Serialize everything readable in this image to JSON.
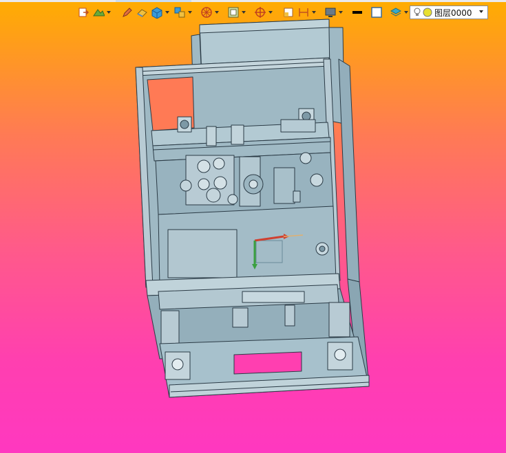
{
  "toolbar": {
    "icons": [
      {
        "name": "exit-icon",
        "caret": false
      },
      {
        "name": "flatten-icon",
        "caret": true
      },
      {
        "name": "pencil-icon",
        "caret": false
      },
      {
        "name": "eraser-icon",
        "caret": false
      },
      {
        "name": "solid-cube-icon",
        "caret": true
      },
      {
        "name": "view-orientation-icon",
        "caret": true
      },
      {
        "name": "wheel-icon",
        "caret": true
      },
      {
        "name": "frame-icon",
        "caret": true
      },
      {
        "name": "target-icon",
        "caret": true
      },
      {
        "name": "section-icon",
        "caret": false
      },
      {
        "name": "dimension-icon",
        "caret": true
      },
      {
        "name": "monitor-icon",
        "caret": true
      },
      {
        "name": "black-line-icon",
        "caret": false
      },
      {
        "name": "white-box-icon",
        "caret": false
      },
      {
        "name": "layers-icon",
        "caret": true
      }
    ]
  },
  "layer": {
    "name": "图层0000",
    "icons": [
      "light-bulb-icon",
      "yellow-circle-icon"
    ]
  },
  "colors": {
    "gradient_top": "#ffad00",
    "gradient_bottom": "#ff38c0",
    "model_fill": "#a7c1cc",
    "model_line": "#2a3a45",
    "model_window": "#ff3fb0"
  }
}
